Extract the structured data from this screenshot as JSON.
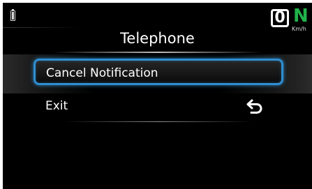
{
  "status": {
    "battery_icon": "battery-icon",
    "speed_value": "0",
    "speed_brand": "N",
    "speed_unit": "Km/h"
  },
  "screen": {
    "title": "Telephone"
  },
  "menu": {
    "items": [
      {
        "label": "Cancel Notification",
        "selected": true
      },
      {
        "label": "Exit",
        "icon": "return-arrow-icon"
      }
    ]
  },
  "colors": {
    "selection_border": "#2f8ed0",
    "brand_green": "#21b24b",
    "background": "#000000"
  }
}
